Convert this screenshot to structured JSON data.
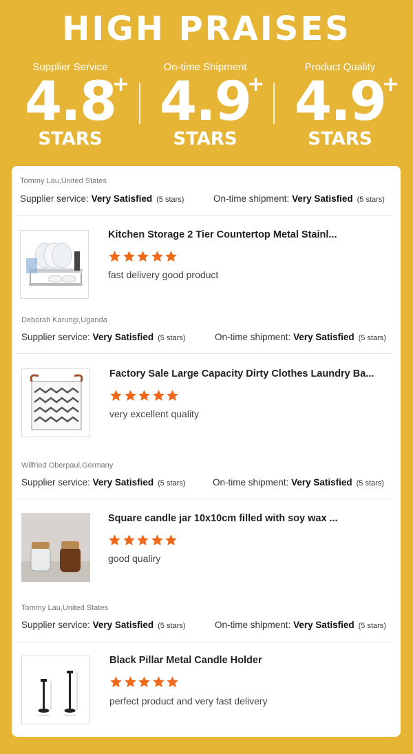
{
  "header": {
    "title": "HIGH PRAISES",
    "stats": [
      {
        "label": "Supplier Service",
        "value": "4.8",
        "plus": "+",
        "unit": "STARS"
      },
      {
        "label": "On-time Shipment",
        "value": "4.9",
        "plus": "+",
        "unit": "STARS"
      },
      {
        "label": "Product Quality",
        "value": "4.9",
        "plus": "+",
        "unit": "STARS"
      }
    ]
  },
  "colors": {
    "background": "#e6b535",
    "star": "#ee6a1a",
    "card": "#ffffff"
  },
  "reviews": [
    {
      "reviewer": "Tommy Lau,United States",
      "supplier_label": "Supplier service:",
      "supplier_value": "Very Satisfied",
      "supplier_stars": "(5 stars)",
      "shipment_label": "On-time shipment:",
      "shipment_value": "Very Satisfied",
      "shipment_stars": "(5 stars)",
      "product_title": "Kitchen Storage 2 Tier Countertop Metal Stainl...",
      "rating": 5,
      "comment": "fast delivery good product",
      "thumbnail": "dish-rack-icon"
    },
    {
      "reviewer": "Deborah Karungi,Uganda",
      "supplier_label": "Supplier service:",
      "supplier_value": "Very Satisfied",
      "supplier_stars": "(5 stars)",
      "shipment_label": "On-time shipment:",
      "shipment_value": "Very Satisfied",
      "shipment_stars": "(5 stars)",
      "product_title": "Factory Sale Large Capacity Dirty Clothes Laundry Ba...",
      "rating": 5,
      "comment": "very excellent quality",
      "thumbnail": "laundry-basket-icon"
    },
    {
      "reviewer": "Wilfried Oberpaul,Germany",
      "supplier_label": "Supplier service:",
      "supplier_value": "Very Satisfied",
      "supplier_stars": "(5 stars)",
      "shipment_label": "On-time shipment:",
      "shipment_value": "Very Satisfied",
      "shipment_stars": "(5 stars)",
      "product_title": "Square candle jar 10x10cm filled with soy wax ...",
      "rating": 5,
      "comment": "good qualiry",
      "thumbnail": "candle-jar-icon"
    },
    {
      "reviewer": "Tommy Lau,United States",
      "supplier_label": "Supplier service:",
      "supplier_value": "Very Satisfied",
      "supplier_stars": "(5 stars)",
      "shipment_label": "On-time shipment:",
      "shipment_value": "Very Satisfied",
      "shipment_stars": "(5 stars)",
      "product_title": "Black Pillar Metal Candle Holder",
      "rating": 5,
      "comment": "perfect product and very fast delivery",
      "thumbnail": "candle-holder-icon"
    }
  ]
}
